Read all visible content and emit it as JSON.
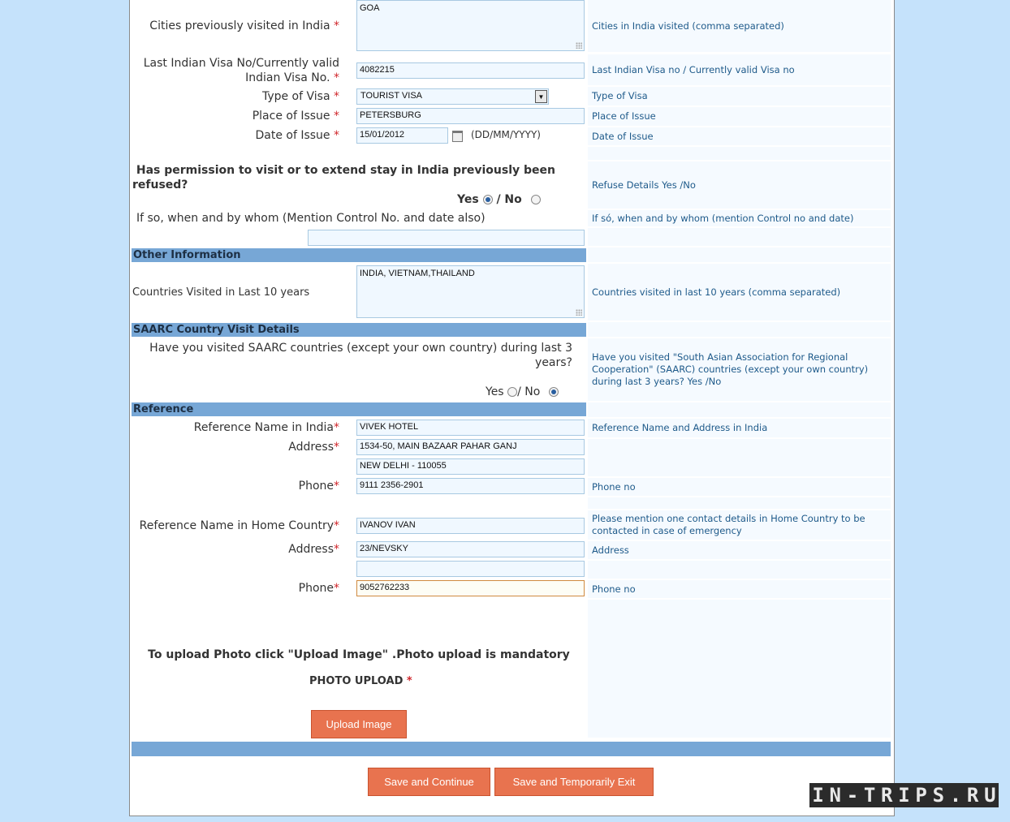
{
  "colors": {
    "background": "#c5e2fb",
    "section_header": "#77a7d6",
    "button": "#e8734f",
    "required": "#d0262b",
    "help_text": "#1e5a8a"
  },
  "fields": {
    "cities": {
      "label": "Cities previously visited in India",
      "value": "GOA",
      "help": "Cities in India visited (comma separated)"
    },
    "last_visa": {
      "label_line1": "Last Indian Visa No/Currently valid",
      "label_line2": "Indian Visa No.",
      "value": "4082215",
      "help": "Last Indian Visa no / Currently valid Visa no"
    },
    "visa_type": {
      "label": "Type of Visa",
      "value": "TOURIST VISA",
      "help": "Type of Visa"
    },
    "place_issue": {
      "label": "Place of Issue",
      "value": "PETERSBURG",
      "help": "Place of Issue"
    },
    "date_issue": {
      "label": "Date of Issue",
      "value": "15/01/2012",
      "format": "(DD/MM/YYYY)",
      "help": "Date of Issue"
    },
    "refused": {
      "question_line1": "Has permission to visit or to extend stay in India previously been",
      "question_line2": "refused?",
      "yes": "Yes",
      "no": "/ No",
      "selected": "Yes",
      "help": "Refuse Details Yes /No"
    },
    "refused_details": {
      "label": "If so, when and by whom (Mention Control No. and date also)",
      "value": "",
      "help": "If só, when and by whom (mention Control no and date)"
    }
  },
  "other": {
    "header": "Other Information",
    "label": "Countries Visited in Last 10 years",
    "value": "INDIA, VIETNAM,THAILAND",
    "help": "Countries visited in last 10 years (comma separated)"
  },
  "saarc": {
    "header": "SAARC Country Visit Details",
    "question_line1": "Have you visited SAARC countries (except your own country) during last 3",
    "question_line2": "years?",
    "yes": "Yes",
    "no": "/ No",
    "selected": "No",
    "help_line1": "Have you visited \"South Asian Association for Regional",
    "help_line2": "Cooperation\" (SAARC) countries (except your own country)",
    "help_line3": "during last 3 years? Yes /No"
  },
  "reference": {
    "header": "Reference",
    "india_name": {
      "label": "Reference Name in India",
      "value": "VIVEK HOTEL",
      "help": "Reference Name and Address in India"
    },
    "india_address": {
      "label": "Address",
      "value1": "1534-50, MAIN BAZAAR PAHAR GANJ",
      "value2": "NEW DELHI - 110055"
    },
    "india_phone": {
      "label": "Phone",
      "value": "9111 2356-2901",
      "help": "Phone no"
    },
    "home_name": {
      "label": "Reference Name in Home Country",
      "value": "IVANOV IVAN",
      "help_line1": "Please mention one contact details in Home Country to be",
      "help_line2": "contacted in case of emergency"
    },
    "home_address": {
      "label": "Address",
      "value1": "23/NEVSKY",
      "value2": "",
      "help": "Address"
    },
    "home_phone": {
      "label": "Phone",
      "value": "9052762233",
      "help": "Phone no"
    }
  },
  "upload": {
    "instruction": "To upload Photo click \"Upload Image\" .Photo upload is mandatory",
    "label": "PHOTO UPLOAD",
    "button": "Upload Image"
  },
  "buttons": {
    "save_continue": "Save and Continue",
    "save_exit": "Save and Temporarily Exit"
  },
  "required_mark": "*",
  "watermark": "IN-TRIPS.RU"
}
